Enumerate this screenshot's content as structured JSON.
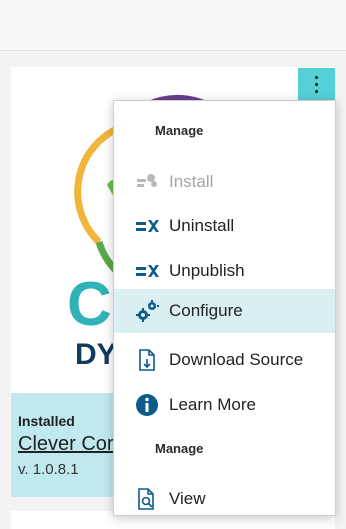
{
  "tile": {
    "status": "Installed",
    "name": "Clever Cor",
    "version": "v. 1.0.8.1",
    "logo_letters": "C",
    "logo_sub": "DY"
  },
  "menu": {
    "header_1": "Manage",
    "header_2": "Manage",
    "items": [
      {
        "label": "Install",
        "icon": "install-icon",
        "disabled": true
      },
      {
        "label": "Uninstall",
        "icon": "uninstall-icon"
      },
      {
        "label": "Unpublish",
        "icon": "unpublish-icon"
      },
      {
        "label": "Configure",
        "icon": "configure-icon",
        "highlighted": true
      },
      {
        "label": "Download Source",
        "icon": "download-source-icon"
      },
      {
        "label": "Learn More",
        "icon": "info-icon"
      },
      {
        "label": "View",
        "icon": "view-icon"
      }
    ]
  },
  "colors": {
    "accent": "#54d0d6",
    "footer_bg": "#bfe9ee",
    "highlight_bg": "#d9eff1",
    "icon_blue": "#0b5c8a"
  }
}
